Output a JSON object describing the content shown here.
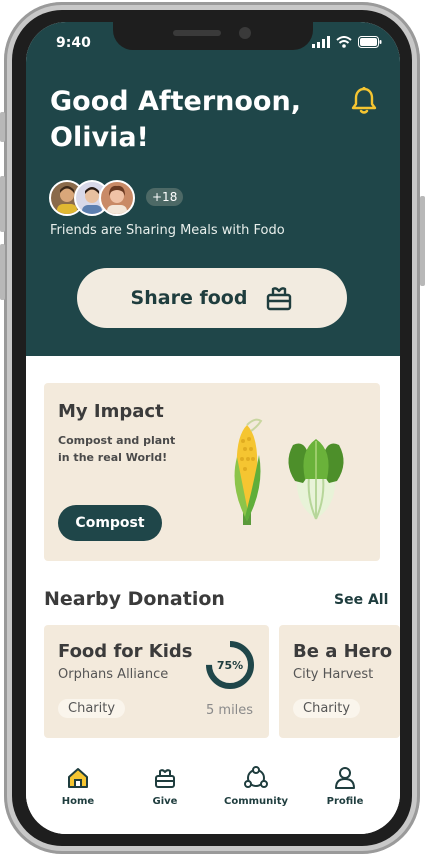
{
  "status_bar": {
    "time": "9:40"
  },
  "header": {
    "greeting": "Good Afternoon, Olivia!",
    "friends_extra_count": "+18",
    "friends_text": "Friends are Sharing Meals with Fodo",
    "share_button_label": "Share food"
  },
  "impact": {
    "title": "My Impact",
    "subtitle": "Compost and plant in the real World!",
    "button_label": "Compost"
  },
  "nearby": {
    "title": "Nearby Donation",
    "see_all_label": "See All",
    "cards": [
      {
        "title": "Food for Kids",
        "org": "Orphans Alliance",
        "tag": "Charity",
        "distance": "5 miles",
        "progress_label": "75%",
        "progress": 0.75
      },
      {
        "title": "Be a Hero",
        "org": "City Harvest",
        "tag": "Charity"
      }
    ]
  },
  "nav": {
    "items": [
      {
        "label": "Home",
        "icon": "home-icon",
        "active": true
      },
      {
        "label": "Give",
        "icon": "gift-box-icon"
      },
      {
        "label": "Community",
        "icon": "community-icon"
      },
      {
        "label": "Profile",
        "icon": "profile-icon"
      }
    ]
  },
  "colors": {
    "header_bg": "#1f4649",
    "card_bg": "#f3eadc",
    "accent_yellow": "#f5c531",
    "button_dark": "#1f4649"
  }
}
